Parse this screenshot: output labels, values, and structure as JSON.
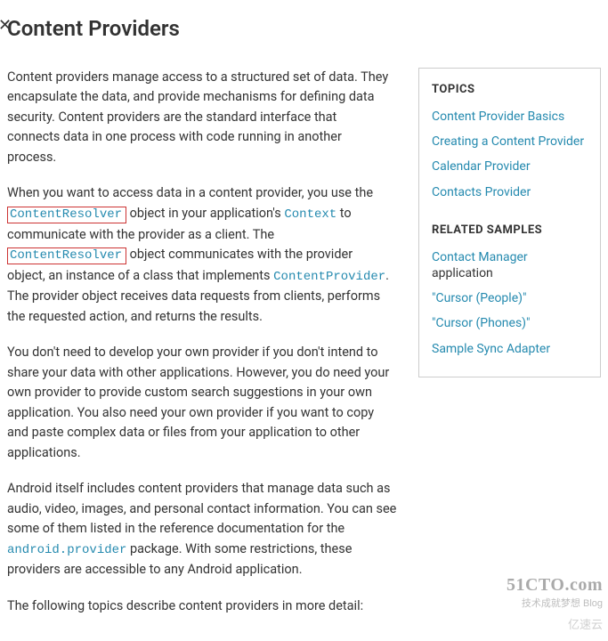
{
  "page": {
    "title": "Content Providers"
  },
  "sidebar": {
    "topics_heading": "TOPICS",
    "topics": {
      "t0": "Content Provider Basics",
      "t1": "Creating a Content Provider",
      "t2": "Calendar Provider",
      "t3": "Contacts Provider"
    },
    "samples_heading": "RELATED SAMPLES",
    "samples": {
      "s0": "Contact Manager",
      "s0_suffix": " application",
      "s1": "\"Cursor (People)\"",
      "s2": "\"Cursor (Phones)\"",
      "s3": "Sample Sync Adapter"
    }
  },
  "para": {
    "p1": "Content providers manage access to a structured set of data. They encapsulate the data, and provide mechanisms for defining data security. Content providers are the standard interface that connects data in one process with code running in another process.",
    "p2a": "When you want to access data in a content provider, you use the ",
    "p2_code1": "ContentResolver",
    "p2b": " object in your application's ",
    "p2_ctx": "Context",
    "p2c": " to communicate with the provider as a client. The ",
    "p2_code2": "ContentResolver",
    "p2d": " object communicates with the provider object, an instance of a class that implements ",
    "p2_cp": "ContentProvider",
    "p2e": ". The provider object receives data requests from clients, performs the requested action, and returns the results.",
    "p3": "You don't need to develop your own provider if you don't intend to share your data with other applications. However, you do need your own provider to provide custom search suggestions in your own application. You also need your own provider if you want to copy and paste complex data or files from your application to other applications.",
    "p4a": "Android itself includes content providers that manage data such as audio, video, images, and personal contact information. You can see some of them listed in the reference documentation for the ",
    "p4_code": "android.provider",
    "p4b": " package. With some restrictions, these providers are accessible to any Android application.",
    "p5": "The following topics describe content providers in more detail:"
  },
  "icons": {
    "close": "✕"
  },
  "watermark": {
    "line1": "51CTO.com",
    "line2": "技术成就梦想      Blog",
    "line3": "亿速云"
  }
}
